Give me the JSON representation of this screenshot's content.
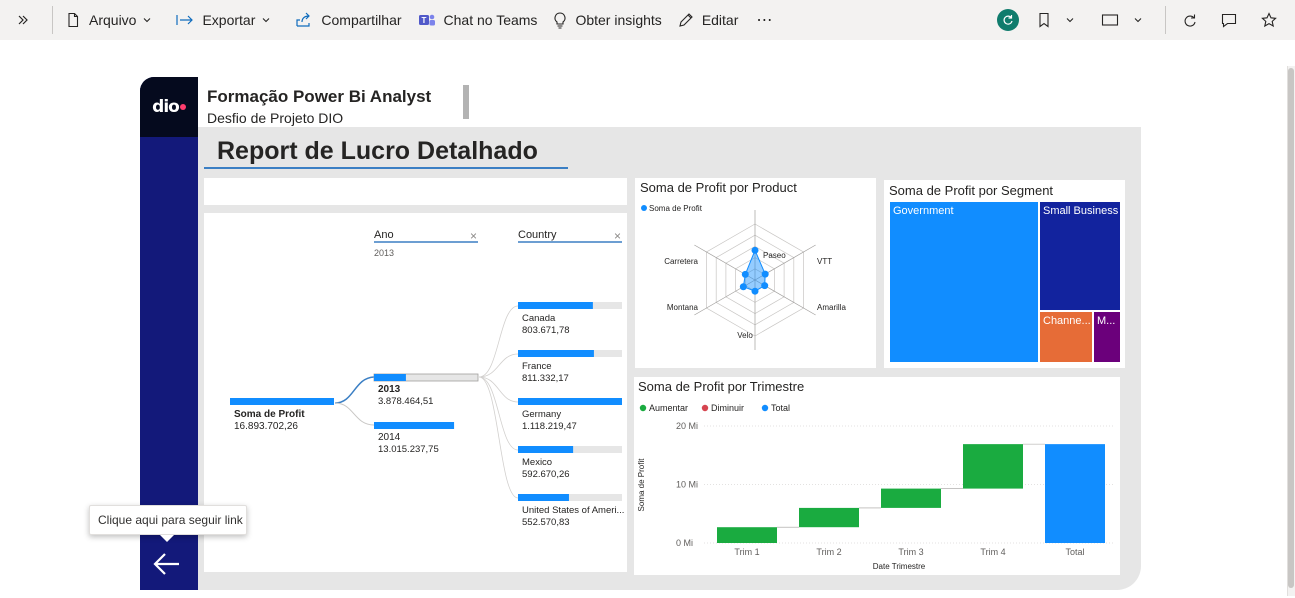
{
  "toolbar": {
    "items": [
      {
        "label": "Arquivo",
        "icon": "file-icon",
        "dropdown": true
      },
      {
        "label": "Exportar",
        "icon": "export-icon",
        "dropdown": true
      },
      {
        "label": "Compartilhar",
        "icon": "share-icon",
        "dropdown": false
      },
      {
        "label": "Chat no Teams",
        "icon": "teams-icon",
        "dropdown": false
      },
      {
        "label": "Obter insights",
        "icon": "lightbulb-icon",
        "dropdown": false
      },
      {
        "label": "Editar",
        "icon": "pencil-icon",
        "dropdown": false
      }
    ],
    "more_label": "⋯"
  },
  "report": {
    "title": "Formação Power Bi Analyst",
    "subtitle": "Desfio de Projeto DIO",
    "heading": "Report de Lucro Detalhado",
    "logo_text": "dio"
  },
  "tooltip": "Clique aqui para seguir link",
  "decomposition": {
    "root_label": "Soma de Profit",
    "root_value": "16.893.702,26",
    "ano_header": "Ano",
    "ano_selected": "2013",
    "country_header": "Country",
    "years": [
      {
        "label": "2013",
        "value": "3.878.464,51",
        "fraction": 0.23
      },
      {
        "label": "2014",
        "value": "13.015.237,75",
        "fraction": 0.77
      }
    ],
    "countries": [
      {
        "label": "Canada",
        "value": "803.671,78",
        "fraction": 0.72
      },
      {
        "label": "France",
        "value": "811.332,17",
        "fraction": 0.73
      },
      {
        "label": "Germany",
        "value": "1.118.219,47",
        "fraction": 1.0
      },
      {
        "label": "Mexico",
        "value": "592.670,26",
        "fraction": 0.53
      },
      {
        "label": "United States of Ameri...",
        "value": "552.570,83",
        "fraction": 0.49
      }
    ]
  },
  "radar": {
    "title": "Soma de Profit por Product",
    "legend": "Soma de Profit",
    "axes": [
      "Paseo",
      "VTT",
      "Amarilla",
      "Velo",
      "Montana",
      "Carretera"
    ]
  },
  "treemap": {
    "title": "Soma de Profit por Segment",
    "items": [
      {
        "label": "Government",
        "color": "#118dff"
      },
      {
        "label": "Small Business",
        "color": "#12239e"
      },
      {
        "label": "Channe...",
        "color": "#e66c37"
      },
      {
        "label": "M...",
        "color": "#6b007b"
      }
    ]
  },
  "waterfall": {
    "title": "Soma de Profit por Trimestre",
    "legend": [
      {
        "label": "Aumentar",
        "color": "#1aab40"
      },
      {
        "label": "Diminuir",
        "color": "#d64550"
      },
      {
        "label": "Total",
        "color": "#118dff"
      }
    ],
    "y_axis_title": "Soma de Profit",
    "x_axis_title": "Date Trimestre",
    "y_ticks": [
      "20 Mi",
      "10 Mi",
      "0 Mi"
    ]
  },
  "chart_data": [
    {
      "type": "radar",
      "title": "Soma de Profit por Product",
      "categories": [
        "Paseo",
        "VTT",
        "Amarilla",
        "Velo",
        "Montana",
        "Carretera"
      ],
      "series": [
        {
          "name": "Soma de Profit",
          "values": [
            0.53,
            0.21,
            0.2,
            0.2,
            0.24,
            0.2
          ]
        }
      ]
    },
    {
      "type": "bar",
      "title": "Soma de Profit por Trimestre",
      "subtype": "waterfall",
      "categories": [
        "Trim 1",
        "Trim 2",
        "Trim 3",
        "Trim 4",
        "Total"
      ],
      "values": [
        2.7,
        3.3,
        3.3,
        7.6,
        16.9
      ],
      "ylim": [
        0,
        20
      ],
      "xlabel": "Date Trimestre",
      "ylabel": "Soma de Profit"
    }
  ]
}
